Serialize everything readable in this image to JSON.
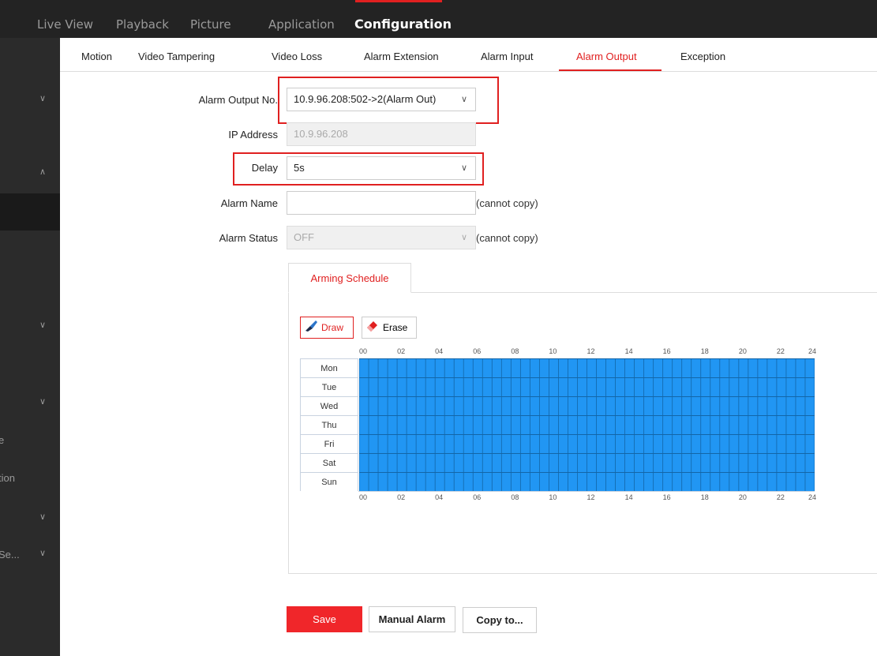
{
  "topnav": {
    "items": [
      "Live View",
      "Playback",
      "Picture",
      "Application",
      "Configuration"
    ],
    "active_index": 4
  },
  "sidebar": {
    "text_partial_1": "e",
    "text_partial_2": "tion",
    "text_partial_3": "Se..."
  },
  "tabs": {
    "items": [
      "Motion",
      "Video Tampering",
      "Video Loss",
      "Alarm Extension",
      "Alarm Input",
      "Alarm Output",
      "Exception"
    ],
    "active_index": 5
  },
  "form": {
    "alarm_output_no_label": "Alarm Output No.",
    "alarm_output_no_value": "10.9.96.208:502->2(Alarm Out)",
    "ip_address_label": "IP Address",
    "ip_address_value": "10.9.96.208",
    "delay_label": "Delay",
    "delay_value": "5s",
    "alarm_name_label": "Alarm Name",
    "alarm_name_value": "",
    "alarm_name_hint": "(cannot copy)",
    "alarm_status_label": "Alarm Status",
    "alarm_status_value": "OFF",
    "alarm_status_hint": "(cannot copy)"
  },
  "schedule": {
    "tab_label": "Arming Schedule",
    "draw_label": "Draw",
    "erase_label": "Erase",
    "hours": [
      "00",
      "02",
      "04",
      "06",
      "08",
      "10",
      "12",
      "14",
      "16",
      "18",
      "20",
      "22",
      "24"
    ],
    "days": [
      "Mon",
      "Tue",
      "Wed",
      "Thu",
      "Fri",
      "Sat",
      "Sun"
    ],
    "armed_fraction": 1.0,
    "armed_color": "#2196f3"
  },
  "buttons": {
    "save": "Save",
    "manual_alarm": "Manual Alarm",
    "copy_to": "Copy to..."
  },
  "colors": {
    "accent": "#e02020",
    "nav_bg": "#232323",
    "sidebar_bg": "#2b2b2b"
  }
}
